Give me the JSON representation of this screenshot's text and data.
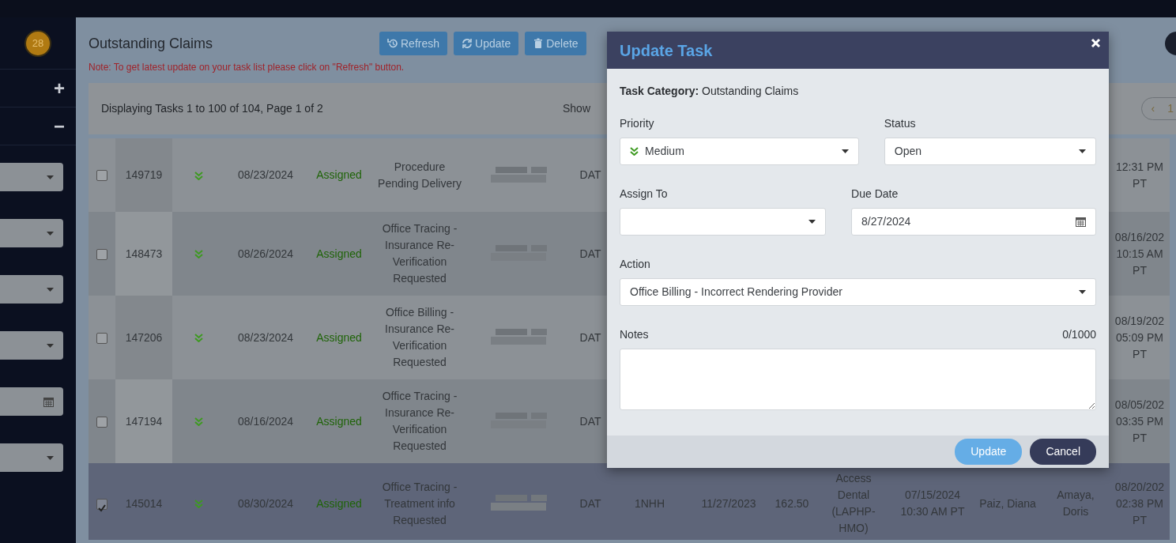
{
  "sidebar": {
    "badge": "28",
    "actions": [
      {
        "label": "+"
      },
      {
        "label": "−"
      }
    ],
    "filters": [
      {
        "kind": "select"
      },
      {
        "kind": "select"
      },
      {
        "kind": "select"
      },
      {
        "kind": "select"
      },
      {
        "kind": "date"
      },
      {
        "kind": "select"
      }
    ]
  },
  "header": {
    "title": "Outstanding Claims",
    "buttons": [
      {
        "kind": "refresh",
        "label": "Refresh"
      },
      {
        "kind": "update",
        "label": "Update"
      },
      {
        "kind": "delete",
        "label": "Delete"
      }
    ],
    "note": "Note: To get latest update on your task list please click on \"Refresh\" button."
  },
  "toolbar": {
    "summary": "Displaying Tasks 1 to 100 of 104, Page 1 of 2",
    "show_label": "Show",
    "pagination": {
      "prev": "‹",
      "page": "1"
    }
  },
  "table": {
    "rows": [
      {
        "checked": false,
        "selected": false,
        "id": "149719",
        "date": "08/23/2024",
        "status": "Assigned",
        "description": "Procedure Pending Delivery",
        "column_8": "DAT",
        "column_16": "12:31 PM PT"
      },
      {
        "checked": false,
        "selected": false,
        "id": "148473",
        "date": "08/26/2024",
        "status": "Assigned",
        "description": "Office Tracing - Insurance Re-Verification Requested",
        "column_8": "DAT",
        "column_16": "08/16/202 10:15 AM PT"
      },
      {
        "checked": false,
        "selected": false,
        "id": "147206",
        "date": "08/23/2024",
        "status": "Assigned",
        "description": "Office Billing - Insurance Re-Verification Requested",
        "column_8": "DAT",
        "column_16": "08/19/202 05:09 PM PT"
      },
      {
        "checked": false,
        "selected": false,
        "id": "147194",
        "date": "08/16/2024",
        "status": "Assigned",
        "description": "Office Tracing - Insurance Re-Verification Requested",
        "column_8": "DAT",
        "column_16": "08/05/202 03:35 PM PT"
      },
      {
        "checked": true,
        "selected": true,
        "id": "145014",
        "date": "08/30/2024",
        "status": "Assigned",
        "description": "Office Tracing - Treatment info Requested",
        "column_8": "DAT",
        "column_9": "1NHH",
        "column_10": "11/27/2023",
        "column_11": "162.50",
        "column_12": "Access Dental (LAPHP-HMO)",
        "column_13": "07/15/2024 10:30 AM PT",
        "column_14": "Paiz, Diana",
        "column_15": "Amaya, Doris",
        "column_16": "08/20/202 02:38 PM PT"
      }
    ]
  },
  "modal": {
    "title": "Update Task",
    "category_label": "Task Category:",
    "category": "Outstanding Claims",
    "field_rows": [
      [
        {
          "kind": "select",
          "label": "Priority",
          "value": "Medium",
          "priority_icon": true
        },
        {
          "kind": "select",
          "label": "Status",
          "value": "Open",
          "priority_icon": false
        }
      ],
      [
        {
          "kind": "select",
          "label": "Assign To",
          "priority_icon": false
        },
        {
          "kind": "date",
          "label": "Due Date",
          "value": "8/27/2024",
          "priority_icon": false
        }
      ],
      [
        {
          "kind": "select",
          "label": "Action",
          "value": "Office Billing - Incorrect Rendering Provider",
          "priority_icon": false
        }
      ],
      [
        {
          "kind": "textarea",
          "label": "Notes",
          "counter": "0/1000"
        }
      ]
    ],
    "buttons": [
      {
        "kind": "primary",
        "label": "Update"
      },
      {
        "kind": "secondary",
        "label": "Cancel"
      }
    ]
  }
}
